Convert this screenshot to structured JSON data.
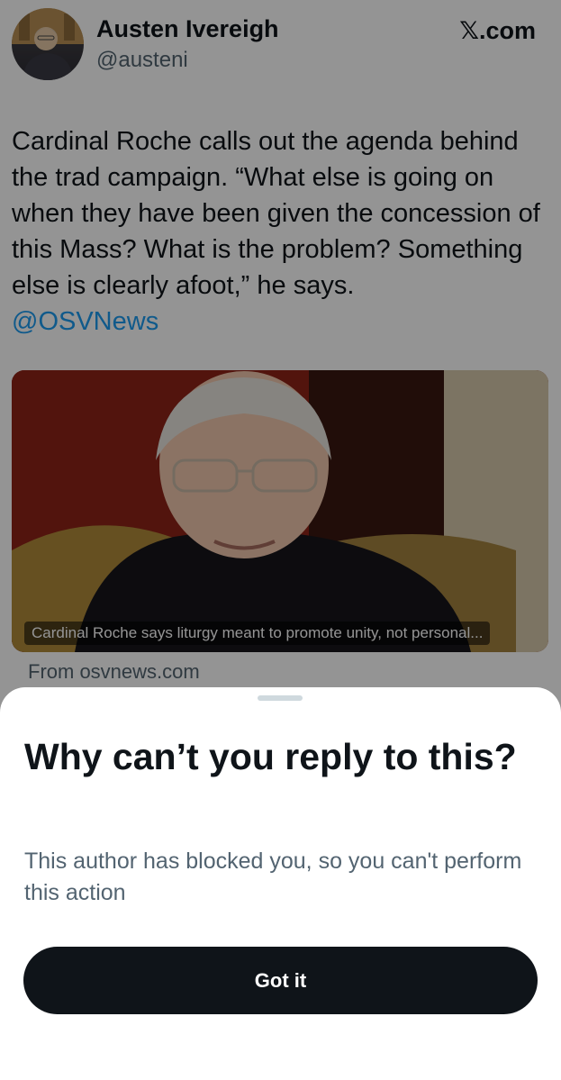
{
  "tweet": {
    "author_name": "Austen Ivereigh",
    "author_handle": "@austeni",
    "site_logo": "𝕏.com",
    "text": "Cardinal Roche calls out the agenda behind the trad campaign. “What else is going on when they have been given the concession of this Mass? What is the problem? Something else is clearly afoot,” he says.",
    "mention": "@OSVNews",
    "card": {
      "caption": "Cardinal Roche says liturgy meant to promote unity, not personal...",
      "source": "From osvnews.com"
    }
  },
  "sheet": {
    "title": "Why can’t you reply to this?",
    "body": "This author has blocked you, so you can't perform this action",
    "button_label": "Got it"
  },
  "colors": {
    "text_primary": "#0f1419",
    "text_secondary": "#536471",
    "link": "#1d9bf0",
    "button_bg": "#0f1419"
  }
}
